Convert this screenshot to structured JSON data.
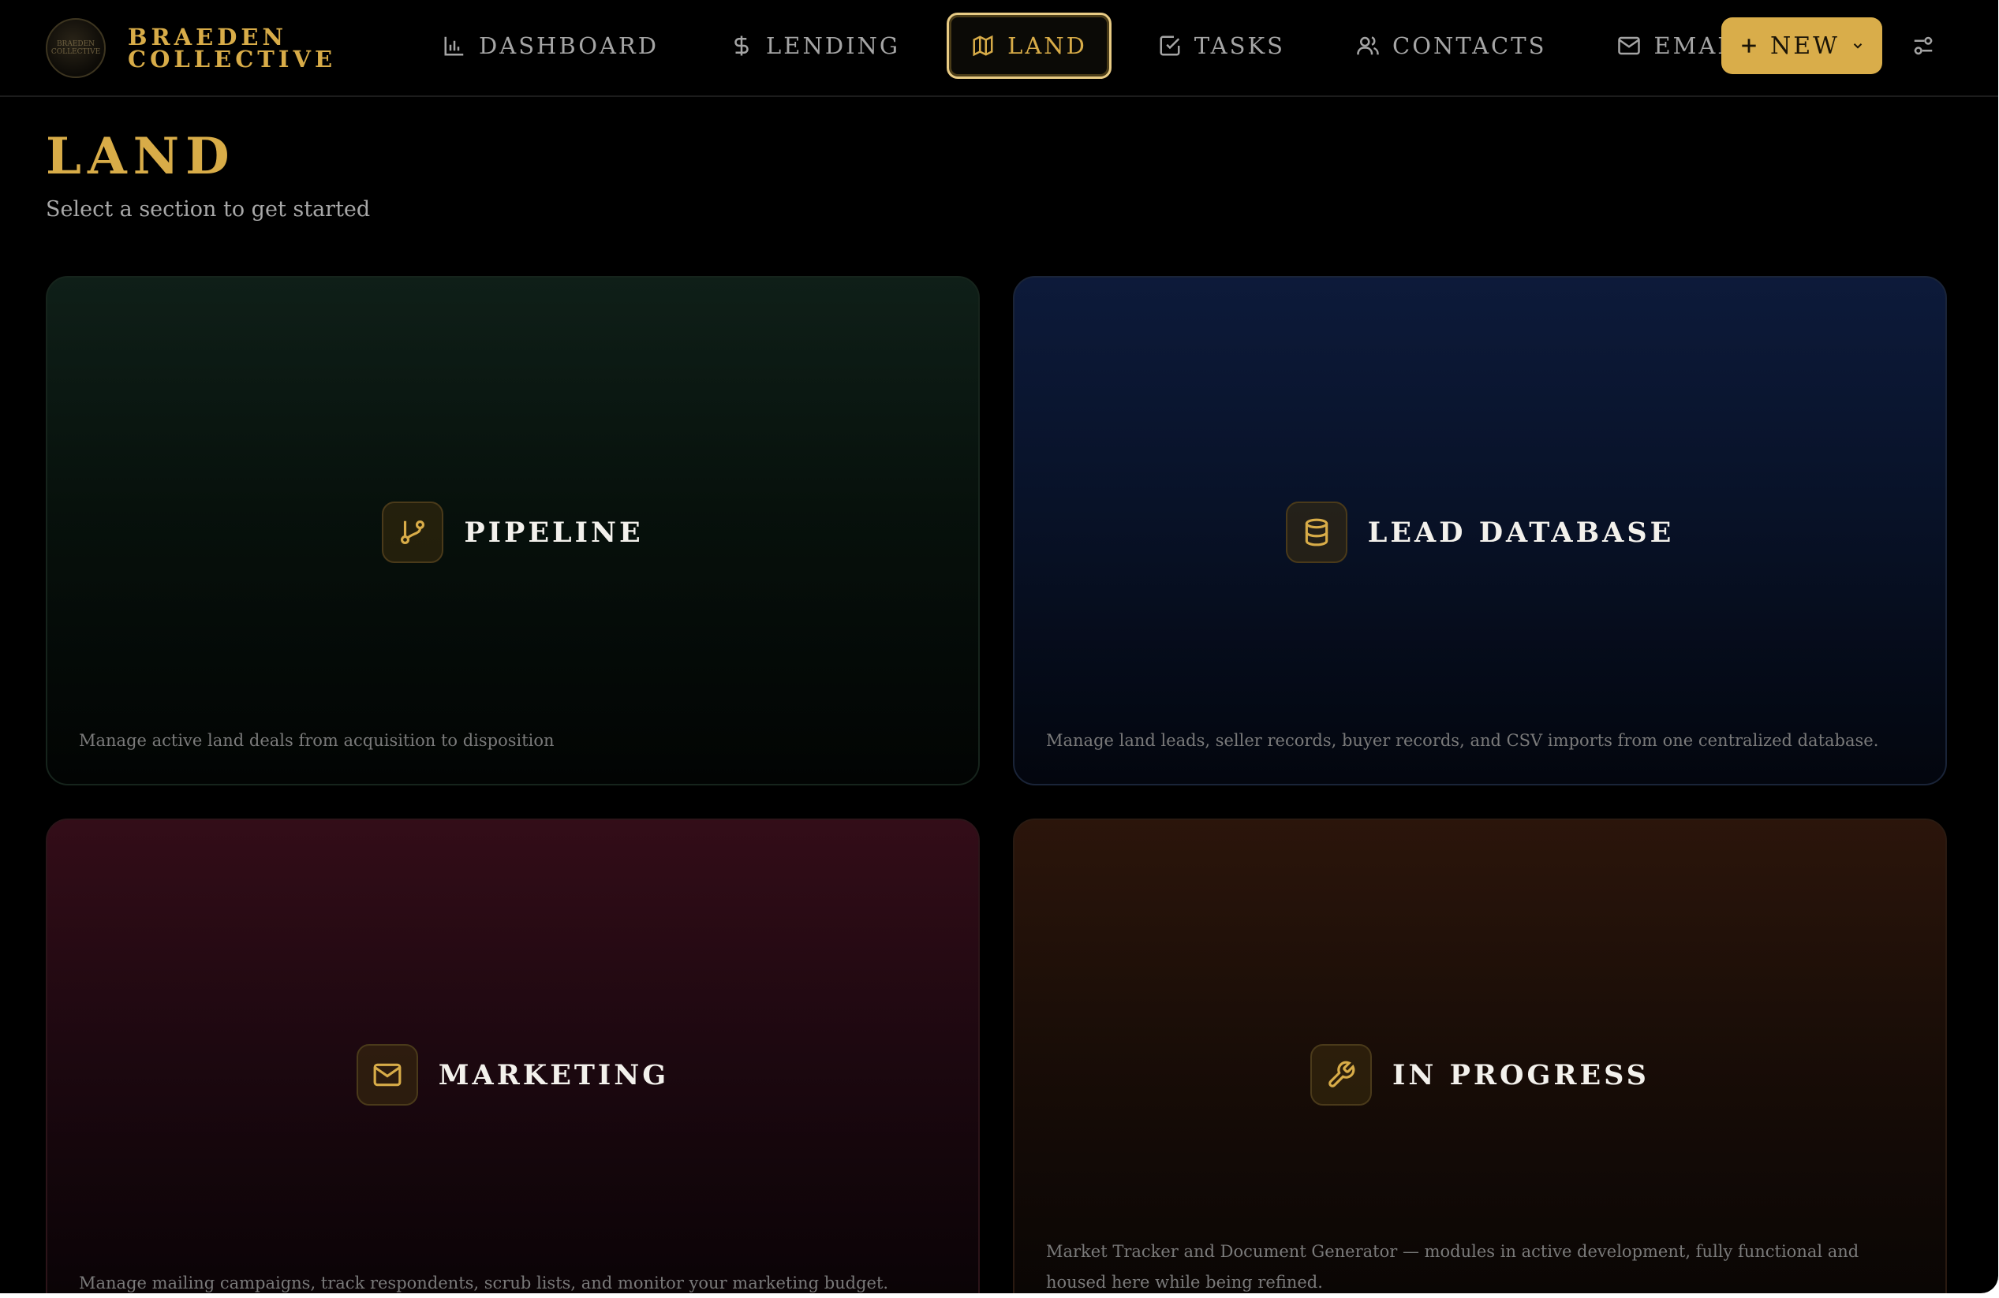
{
  "brand": {
    "line1": "BRAEDEN",
    "line2": "COLLECTIVE",
    "logo_text": "BRAEDEN COLLECTIVE"
  },
  "nav": {
    "items": [
      {
        "label": "DASHBOARD",
        "icon": "bar-chart-icon"
      },
      {
        "label": "LENDING",
        "icon": "dollar-icon"
      },
      {
        "label": "LAND",
        "icon": "map-icon",
        "active": true
      },
      {
        "label": "TASKS",
        "icon": "checkbox-icon"
      },
      {
        "label": "CONTACTS",
        "icon": "users-icon"
      },
      {
        "label": "EMAILS",
        "icon": "mail-icon"
      }
    ],
    "new_label": "NEW"
  },
  "page": {
    "title": "LAND",
    "subtitle": "Select a section to get started"
  },
  "cards": [
    {
      "title": "PIPELINE",
      "icon": "git-branch-icon",
      "description": "Manage active land deals from acquisition to disposition"
    },
    {
      "title": "LEAD DATABASE",
      "icon": "database-icon",
      "description": "Manage land leads, seller records, buyer records, and CSV imports from one centralized database."
    },
    {
      "title": "MARKETING",
      "icon": "mail-icon",
      "description": "Manage mailing campaigns, track respondents, scrub lists, and monitor your marketing budget."
    },
    {
      "title": "IN PROGRESS",
      "icon": "wrench-icon",
      "description": "Market Tracker and Document Generator — modules in active development, fully functional and housed here while being refined."
    }
  ],
  "colors": {
    "accent_gold": "#d8ac48",
    "background": "#000000",
    "nav_text": "#a5a5a5"
  }
}
